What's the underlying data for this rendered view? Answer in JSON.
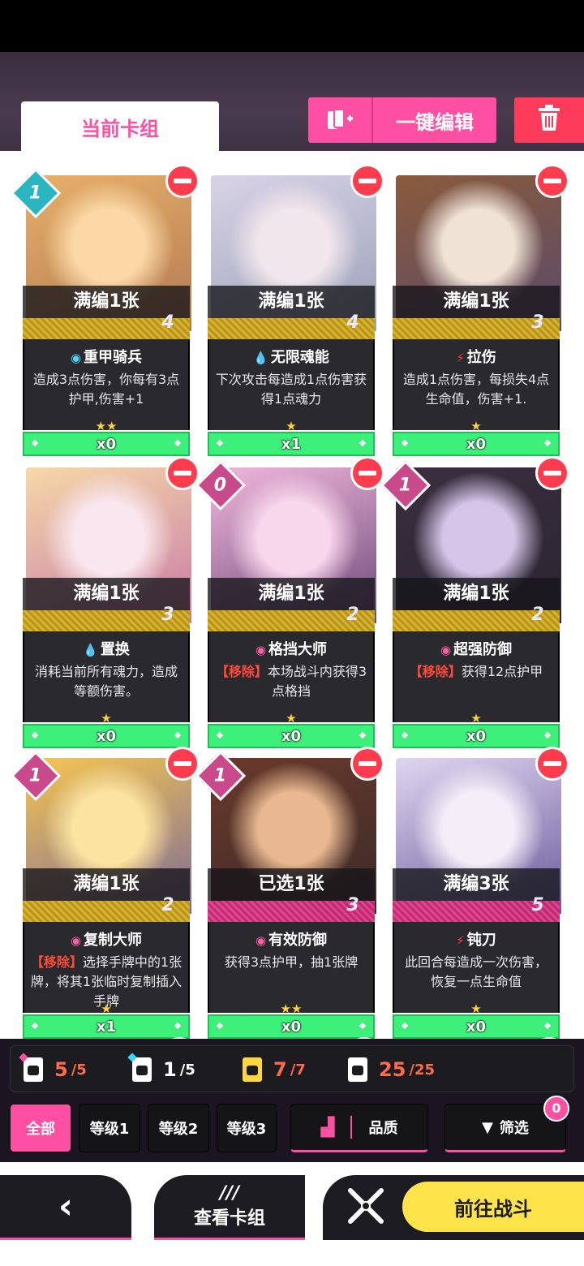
{
  "header": {
    "tab_current": "当前卡组",
    "edit_label": "一键编辑"
  },
  "cards": [
    {
      "level": "1",
      "level_color": "#2bb5c0",
      "name_bar": "满编1张",
      "cost": "4",
      "skill_icon": "◉",
      "skill_icon_color": "#4fd6ff",
      "skill": "重甲骑兵",
      "desc": "造成3点伤害，你每有3点护甲,伤害+1",
      "removal": "",
      "stars": "★★",
      "count": "x0",
      "stripe": "gold",
      "art": [
        "#e8b06a",
        "#fbd8a5",
        "#b07a52"
      ]
    },
    {
      "level": "",
      "level_color": "",
      "name_bar": "满编1张",
      "cost": "4",
      "skill_icon": "💧",
      "skill_icon_color": "#4fd6ff",
      "skill": "无限魂能",
      "desc": "下次攻击每造成1点伤害获得1点魂力",
      "removal": "",
      "stars": "★",
      "count": "x1",
      "stripe": "gold",
      "art": [
        "#d9d3e6",
        "#f1e6ec",
        "#9aa0b8"
      ]
    },
    {
      "level": "",
      "level_color": "",
      "name_bar": "满编1张",
      "cost": "3",
      "skill_icon": "⚡",
      "skill_icon_color": "#ff3b3b",
      "skill": "拉伤",
      "desc": "造成1点伤害，每损失4点生命值，伤害+1.",
      "removal": "",
      "stars": "★",
      "count": "x0",
      "stripe": "gold",
      "art": [
        "#8a5b3c",
        "#f0e3d6",
        "#5a4a6a"
      ]
    },
    {
      "level": "",
      "level_color": "",
      "name_bar": "满编1张",
      "cost": "3",
      "skill_icon": "💧",
      "skill_icon_color": "#4fd6ff",
      "skill": "置换",
      "desc": "消耗当前所有魂力，造成等额伤害。",
      "removal": "",
      "stars": "★",
      "count": "x0",
      "stripe": "gold",
      "art": [
        "#f6d8a8",
        "#f9e6ee",
        "#c77aa6"
      ]
    },
    {
      "level": "0",
      "level_color": "#c94a8a",
      "name_bar": "满编1张",
      "cost": "2",
      "skill_icon": "◉",
      "skill_icon_color": "#ff5fa8",
      "skill": "格挡大师",
      "desc": "本场战斗内获得3点格挡",
      "removal": "【移除】",
      "stars": "★",
      "count": "x0",
      "stripe": "gold",
      "art": [
        "#f2b7dc",
        "#f8d6ec",
        "#6a4a7a"
      ]
    },
    {
      "level": "1",
      "level_color": "#c94a8a",
      "name_bar": "满编1张",
      "cost": "2",
      "skill_icon": "◉",
      "skill_icon_color": "#ff5fa8",
      "skill": "超强防御",
      "desc": "获得12点护甲",
      "removal": "【移除】",
      "stars": "★",
      "count": "x0",
      "stripe": "gold",
      "art": [
        "#3a2f40",
        "#d6c4e8",
        "#2a2430"
      ]
    },
    {
      "level": "1",
      "level_color": "#c94a8a",
      "name_bar": "满编1张",
      "cost": "2",
      "skill_icon": "◉",
      "skill_icon_color": "#ff5fa8",
      "skill": "复制大师",
      "desc": "选择手牌中的1张牌，将其1张临时复制插入手牌",
      "removal": "【移除】",
      "stars": "★",
      "count": "x1",
      "stripe": "gold",
      "art": [
        "#f6c650",
        "#fbe3a0",
        "#7a6a9a"
      ]
    },
    {
      "level": "1",
      "level_color": "#c94a8a",
      "name_bar": "已选1张",
      "cost": "3",
      "skill_icon": "◉",
      "skill_icon_color": "#ff5fa8",
      "skill": "有效防御",
      "desc": "获得3点护甲，抽1张牌",
      "removal": "",
      "stars": "★★",
      "count": "x0",
      "stripe": "pink",
      "art": [
        "#6a3a2a",
        "#e8b890",
        "#3a2a2a"
      ]
    },
    {
      "level": "",
      "level_color": "",
      "name_bar": "满编3张",
      "cost": "5",
      "skill_icon": "⚡",
      "skill_icon_color": "#ff3b3b",
      "skill": "钝刀",
      "desc": "此回合每造成一次伤害，恢复一点生命值",
      "removal": "",
      "stars": "★",
      "count": "x0",
      "stripe": "pink",
      "art": [
        "#e0d6f0",
        "#f4eef8",
        "#6a5a9a"
      ]
    }
  ],
  "stats": [
    {
      "value": "5",
      "total": "/5",
      "icon": "deck-pink-icon",
      "color": "#ff6a4a"
    },
    {
      "value": "1",
      "total": "/5",
      "icon": "deck-cyan-icon",
      "color": "#ffffff"
    },
    {
      "value": "7",
      "total": "/7",
      "icon": "cat-yellow-icon",
      "color": "#ff6a4a"
    },
    {
      "value": "25",
      "total": "/25",
      "icon": "cards-icon",
      "color": "#ff6a4a"
    }
  ],
  "filters": {
    "all": "全部",
    "lv1": "等级1",
    "lv2": "等级2",
    "lv3": "等级3",
    "quality": "品质",
    "screen": "筛选",
    "screen_badge": "0"
  },
  "bottom": {
    "view_deck": "查看卡组",
    "battle": "前往战斗"
  }
}
